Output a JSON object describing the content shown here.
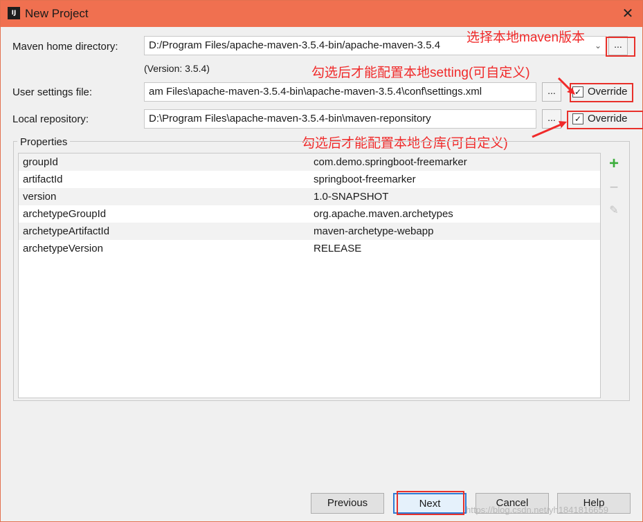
{
  "window": {
    "title": "New Project",
    "icon_label": "IJ"
  },
  "maven_home": {
    "label": "Maven home directory:",
    "value": "D:/Program Files/apache-maven-3.5.4-bin/apache-maven-3.5.4",
    "version": "(Version: 3.5.4)"
  },
  "user_settings": {
    "label": "User settings file:",
    "value": "am Files\\apache-maven-3.5.4-bin\\apache-maven-3.5.4\\conf\\settings.xml",
    "override_label": "Override",
    "override_checked": true
  },
  "local_repo": {
    "label": "Local repository:",
    "value": "D:\\Program Files\\apache-maven-3.5.4-bin\\maven-reponsitory",
    "override_label": "Override",
    "override_checked": true
  },
  "browse_label": "...",
  "annotations": {
    "maven_version": "选择本地maven版本",
    "setting": "勾选后才能配置本地setting(可自定义)",
    "repo": "勾选后才能配置本地仓库(可自定义)"
  },
  "properties": {
    "title": "Properties",
    "rows": [
      {
        "key": "groupId",
        "value": "com.demo.springboot-freemarker"
      },
      {
        "key": "artifactId",
        "value": "springboot-freemarker"
      },
      {
        "key": "version",
        "value": "1.0-SNAPSHOT"
      },
      {
        "key": "archetypeGroupId",
        "value": "org.apache.maven.archetypes"
      },
      {
        "key": "archetypeArtifactId",
        "value": "maven-archetype-webapp"
      },
      {
        "key": "archetypeVersion",
        "value": "RELEASE"
      }
    ]
  },
  "buttons": {
    "previous": "Previous",
    "next": "Next",
    "cancel": "Cancel",
    "help": "Help"
  },
  "watermark": "https://blog.csdn.net/yh1841816659",
  "colors": {
    "titlebar": "#f07050",
    "annotation": "#f02a2a",
    "add": "#3cae3c"
  }
}
